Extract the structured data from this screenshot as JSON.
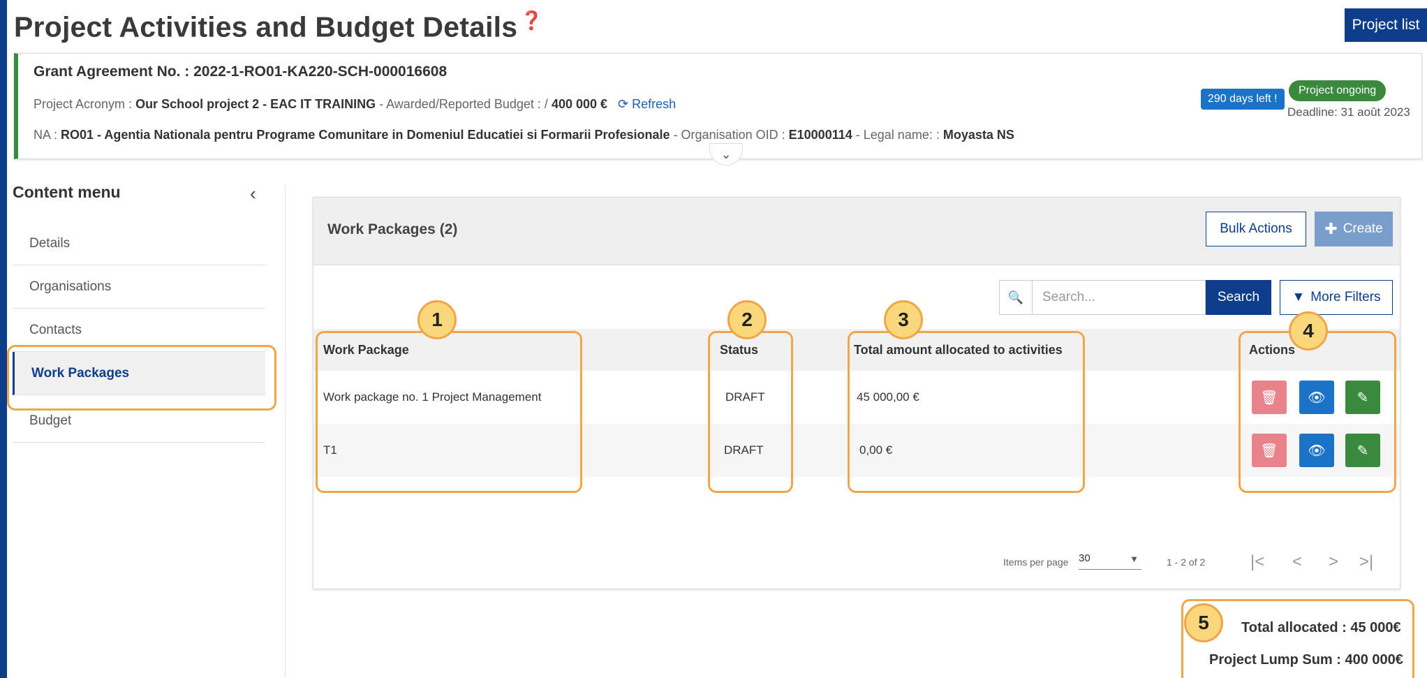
{
  "page": {
    "title": "Project Activities and Budget Details",
    "project_list_label": "Project list"
  },
  "header": {
    "grant_agreement": "Grant Agreement No. : 2022-1-RO01-KA220-SCH-000016608",
    "acronym_label": "Project Acronym :",
    "acronym_value": "Our School project 2 - EAC IT TRAINING",
    "budget_label": "- Awarded/Reported Budget : /",
    "budget_value": "400 000 €",
    "refresh_label": "Refresh",
    "na_label": "NA :",
    "na_value": "RO01 - Agentia Nationala pentru Programe Comunitare in Domeniul Educatiei si Formarii Profesionale",
    "oid_label": "- Organisation OID :",
    "oid_value": "E10000114",
    "legal_label": "- Legal name: :",
    "legal_value": "Moyasta NS",
    "days_left": "290 days left !",
    "status": "Project ongoing",
    "deadline": "Deadline: 31 août 2023"
  },
  "sidebar": {
    "title": "Content menu",
    "items": [
      {
        "label": "Details"
      },
      {
        "label": "Organisations"
      },
      {
        "label": "Contacts"
      },
      {
        "label": "Work Packages"
      },
      {
        "label": "Budget"
      }
    ]
  },
  "work_packages": {
    "title": "Work Packages (2)",
    "bulk_actions": "Bulk Actions",
    "create": "Create",
    "search_placeholder": "Search...",
    "search_button": "Search",
    "more_filters": "More Filters",
    "columns": [
      "Work Package",
      "Status",
      "Total amount allocated to activities",
      "Actions"
    ],
    "rows": [
      {
        "name": "Work package no. 1 Project Management",
        "status": "DRAFT",
        "amount": "45 000,00 €"
      },
      {
        "name": "T1",
        "status": "DRAFT",
        "amount": "0,00 €"
      }
    ],
    "pagination": {
      "items_per_page_label": "Items per page",
      "items_per_page": "30",
      "range": "1 - 2 of 2"
    }
  },
  "totals": {
    "allocated": "Total allocated : 45 000€",
    "lump_sum": "Project Lump Sum : 400 000€"
  },
  "callouts": [
    "1",
    "2",
    "3",
    "4",
    "5"
  ],
  "colors": {
    "primary": "#0e3d8c",
    "success": "#3a8a3e",
    "info": "#1a73c7",
    "danger_light": "#e8838c",
    "highlight": "#f0a548",
    "callout_fill": "#f9d77a"
  }
}
